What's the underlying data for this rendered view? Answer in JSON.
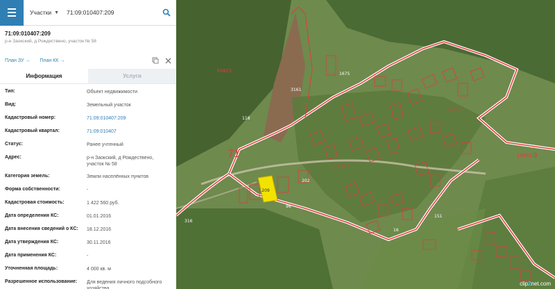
{
  "search": {
    "type_label": "Участки",
    "value": "71:09:010407:209"
  },
  "object": {
    "title": "71:09:010407:209",
    "subtitle": "р-н Заокский, д Рождествено, участок № 58"
  },
  "links": {
    "plan_zu": "План ЗУ",
    "plan_kk": "План КК"
  },
  "tabs": [
    {
      "label": "Информация",
      "active": true
    },
    {
      "label": "Услуги",
      "active": false
    }
  ],
  "info": {
    "type": {
      "label": "Тип:",
      "value": "Объект недвижимости"
    },
    "kind": {
      "label": "Вид:",
      "value": "Земельный участок"
    },
    "cad_number": {
      "label": "Кадастровый номер:",
      "value": "71:09:010407:209"
    },
    "cad_quarter": {
      "label": "Кадастровый квартал:",
      "value": "71:09:010407"
    },
    "status": {
      "label": "Статус:",
      "value": "Ранее учтенный"
    },
    "address": {
      "label": "Адрес:",
      "value": "р-н Заокский, д Рождествено, участок № 58"
    },
    "land_category": {
      "label": "Категория земель:",
      "value": "Земли населённых пунктов"
    },
    "ownership": {
      "label": "Форма собственности:",
      "value": "-"
    },
    "cad_value": {
      "label": "Кадастровая стоимость:",
      "value": "1 422 560 руб."
    },
    "ks_date": {
      "label": "Дата определения КС:",
      "value": "01.01.2016"
    },
    "ks_entry_date": {
      "label": "Дата внесения сведений о КС:",
      "value": "18.12.2016"
    },
    "ks_approval_date": {
      "label": "Дата утверждения КС:",
      "value": "30.11.2016"
    },
    "ks_apply_date": {
      "label": "Дата применения КС:",
      "value": "-"
    },
    "area": {
      "label": "Уточненная площадь:",
      "value": "4 000 кв. м"
    },
    "permitted_use": {
      "label": "Разрешенное использование:",
      "value": "Для ведения личного подсобного хозяйства"
    }
  },
  "map": {
    "big_labels": [
      "71",
      "9"
    ],
    "quarter_labels": [
      "10401",
      "10407",
      "10407",
      "10401"
    ],
    "parcel_labels": [
      "3161",
      "1675",
      "118",
      "202",
      "316",
      "96",
      "16",
      "151"
    ],
    "selected_parcel": "209"
  },
  "watermark": {
    "pre": "clip",
    "accent": "2",
    "post": "net.com"
  },
  "colors": {
    "accent": "#2f7fb5",
    "boundary": "#e23b3b",
    "selected": "#f2e200"
  }
}
